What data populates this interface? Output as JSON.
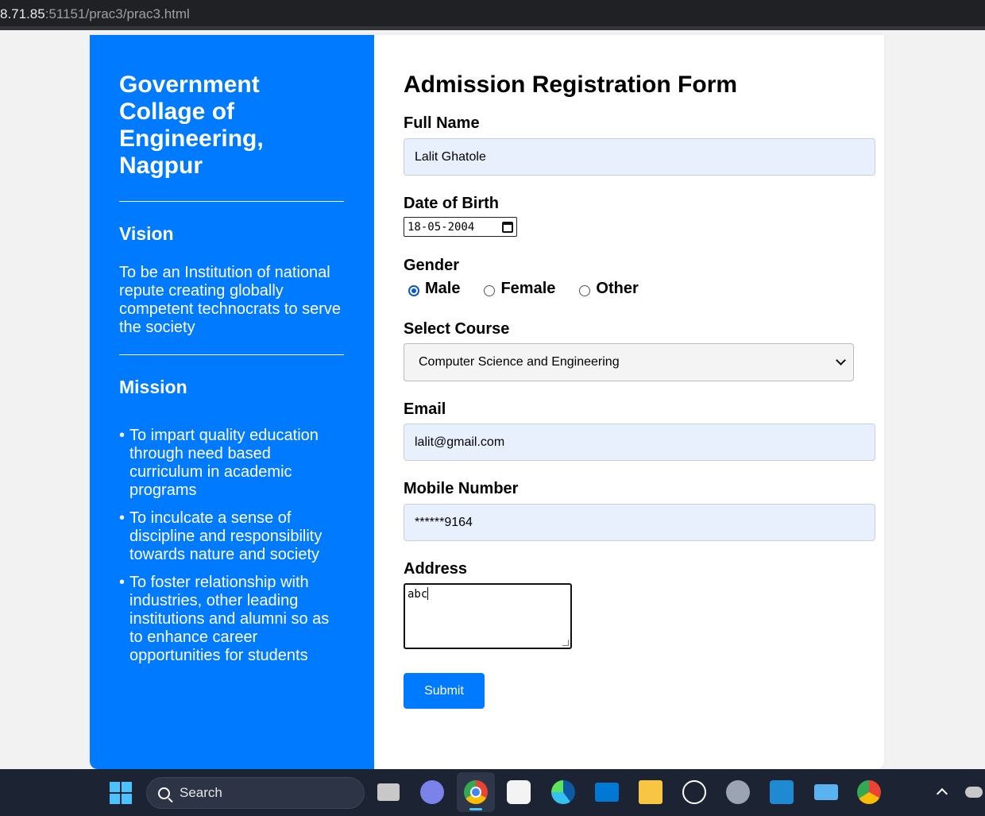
{
  "browser": {
    "url_host": "8.71.85",
    "url_rest": ":51151/prac3/prac3.html"
  },
  "sidebar": {
    "college_name": "Government Collage of Engineering, Nagpur",
    "vision_heading": "Vision",
    "vision_text": "To be an Institution of national repute creating globally competent technocrats to serve the society",
    "mission_heading": "Mission",
    "mission_items": [
      "To impart quality education through need based curriculum in academic programs",
      "To inculcate a sense of discipline and responsibility towards nature and society",
      "To foster relationship with industries, other leading institutions and alumni so as to enhance career opportunities for students"
    ]
  },
  "form": {
    "title": "Admission Registration Form",
    "full_name_label": "Full Name",
    "full_name_value": "Lalit Ghatole",
    "dob_label": "Date of Birth",
    "dob_value": "18-05-2004",
    "gender_label": "Gender",
    "gender_options": [
      "Male",
      "Female",
      "Other"
    ],
    "gender_selected": "Male",
    "course_label": "Select Course",
    "course_value": "Computer Science and Engineering",
    "email_label": "Email",
    "email_value": "lalit@gmail.com",
    "mobile_label": "Mobile Number",
    "mobile_value": "******9164",
    "address_label": "Address",
    "address_value": "abc",
    "submit_label": "Submit"
  },
  "taskbar": {
    "search_label": "Search",
    "icons": [
      "windows-start-icon",
      "task-view-icon",
      "meet-icon",
      "chrome-icon",
      "store-icon",
      "edge-icon",
      "mail-icon",
      "file-explorer-icon",
      "dell-icon",
      "settings-icon",
      "vscode-icon",
      "remote-icon",
      "chrome-profile-icon"
    ]
  },
  "colors": {
    "sidebar_bg": "#007bff",
    "button_bg": "#007bff",
    "autofill_bg": "#e8f0fe",
    "taskbar_bg": "#1c2333"
  }
}
